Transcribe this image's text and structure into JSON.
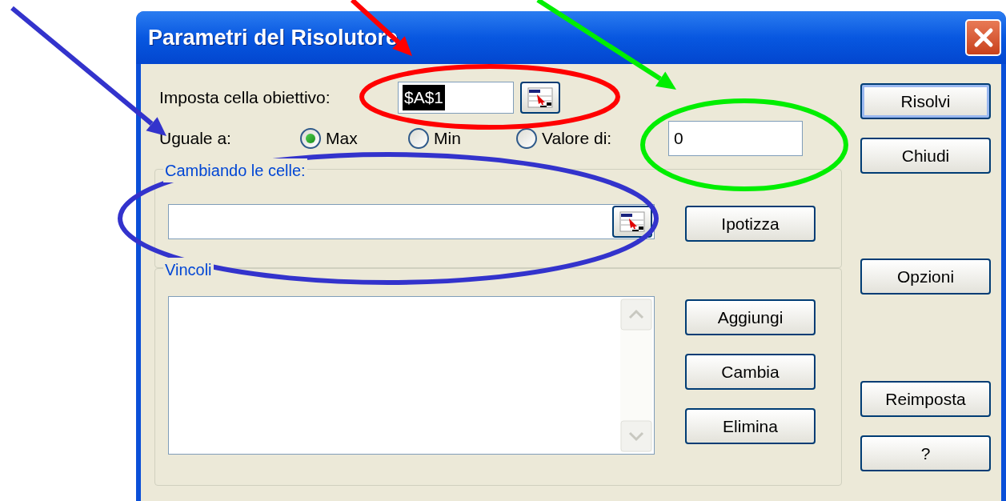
{
  "window": {
    "title": "Parametri del Risolutore"
  },
  "objective": {
    "label": "Imposta cella obiettivo:",
    "value": "$A$1",
    "selected": true
  },
  "equal_to": {
    "label": "Uguale a:",
    "value": "0",
    "options": [
      {
        "label": "Max",
        "selected": true
      },
      {
        "label": "Min",
        "selected": false
      },
      {
        "label": "Valore di:",
        "selected": false
      }
    ]
  },
  "changing_cells": {
    "title": "Cambiando le celle:",
    "button": "Ipotizza"
  },
  "constraints": {
    "title": "Vincoli",
    "buttons": [
      "Aggiungi",
      "Cambia",
      "Elimina"
    ]
  },
  "side_buttons": [
    {
      "label": "Risolvi",
      "default": true
    },
    {
      "label": "Chiudi",
      "default": false
    },
    {
      "label": "Opzioni",
      "default": false
    },
    {
      "label": "Reimposta",
      "default": false
    },
    {
      "label": "?",
      "default": false
    }
  ],
  "annotations": {
    "arrows": [
      {
        "color": "#3333cc"
      },
      {
        "color": "#ff0000"
      },
      {
        "color": "#00ee00"
      }
    ],
    "ellipses": [
      {
        "color": "#ff0000"
      },
      {
        "color": "#00ee00"
      },
      {
        "color": "#3333cc"
      }
    ]
  }
}
